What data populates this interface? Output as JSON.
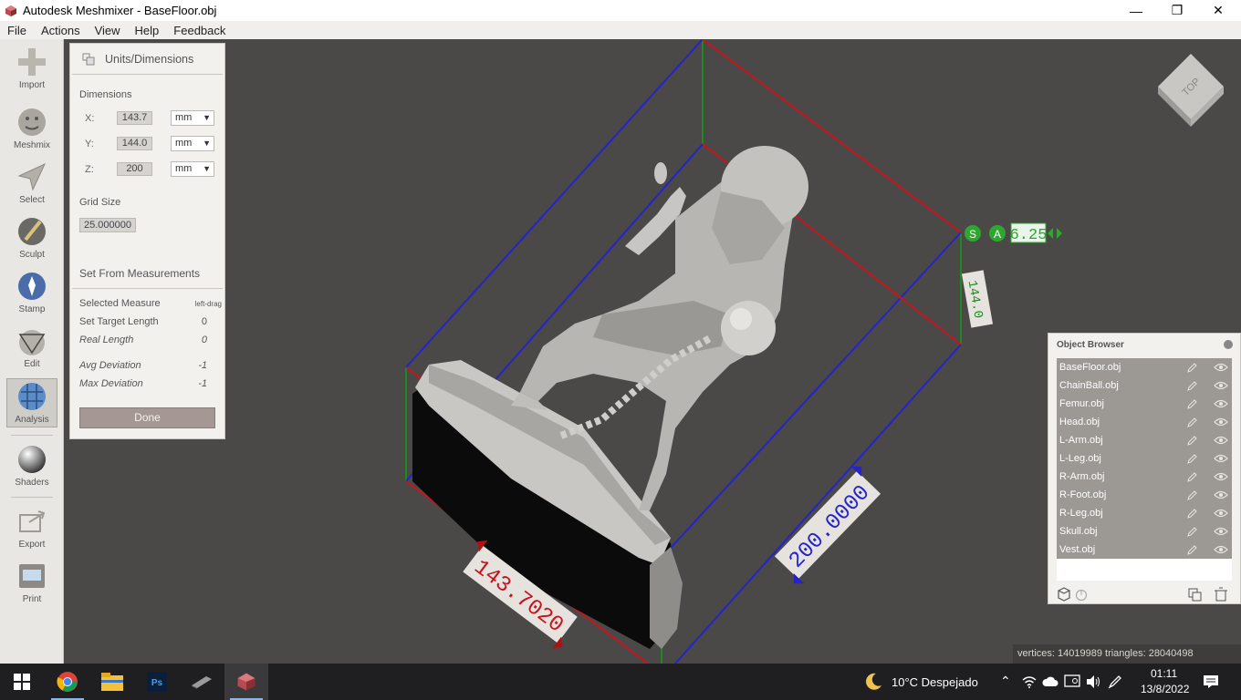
{
  "window": {
    "title": "Autodesk Meshmixer - BaseFloor.obj",
    "minimize_glyph": "—",
    "maximize_glyph": "❐",
    "close_glyph": "✕"
  },
  "menu": [
    "File",
    "Actions",
    "View",
    "Help",
    "Feedback"
  ],
  "toolbar": {
    "tools": [
      {
        "label": "Import",
        "icon": "import-icon"
      },
      {
        "label": "Meshmix",
        "icon": "meshmix-icon"
      },
      {
        "label": "Select",
        "icon": "select-arrow-icon"
      },
      {
        "label": "Sculpt",
        "icon": "sculpt-brush-icon"
      },
      {
        "label": "Stamp",
        "icon": "stamp-icon"
      },
      {
        "label": "Edit",
        "icon": "edit-icon"
      },
      {
        "label": "Analysis",
        "icon": "analysis-icon",
        "active": true
      },
      {
        "label": "Shaders",
        "icon": "shaders-sphere-icon"
      },
      {
        "label": "Export",
        "icon": "export-icon"
      },
      {
        "label": "Print",
        "icon": "print-icon"
      }
    ]
  },
  "units_panel": {
    "title": "Units/Dimensions",
    "dimensions_label": "Dimensions",
    "dims": [
      {
        "axis": "X:",
        "value": "143.7",
        "unit": "mm"
      },
      {
        "axis": "Y:",
        "value": "144.0",
        "unit": "mm"
      },
      {
        "axis": "Z:",
        "value": "200",
        "unit": "mm"
      }
    ],
    "grid_label": "Grid Size",
    "grid_value": "25.000000",
    "measure_title": "Set From Measurements",
    "rows": [
      {
        "label": "Selected Measure",
        "value": "left-drag",
        "italic": false
      },
      {
        "label": "Set Target Length",
        "value": "0",
        "italic": false
      },
      {
        "label": "Real Length",
        "value": "0",
        "italic": true
      },
      {
        "label": "Avg Deviation",
        "value": "-1",
        "italic": true
      },
      {
        "label": "Max Deviation",
        "value": "-1",
        "italic": true
      }
    ],
    "done_label": "Done"
  },
  "viewport": {
    "dim_x_label": "143.7020",
    "dim_z_label": "200.0000",
    "dim_y_label": "144.0",
    "s_badge": "S",
    "a_badge": "A",
    "grid_readout": "6.25",
    "viewcube_face": "TOP"
  },
  "object_browser": {
    "title": "Object Browser",
    "items": [
      "BaseFloor.obj",
      "ChainBall.obj",
      "Femur.obj",
      "Head.obj",
      "L-Arm.obj",
      "L-Leg.obj",
      "R-Arm.obj",
      "R-Foot.obj",
      "R-Leg.obj",
      "Skull.obj",
      "Vest.obj"
    ]
  },
  "status": {
    "stats": "vertices: 14019989 triangles: 28040498"
  },
  "taskbar": {
    "weather": "10°C  Despejado",
    "time": "01:11",
    "date": "13/8/2022"
  }
}
